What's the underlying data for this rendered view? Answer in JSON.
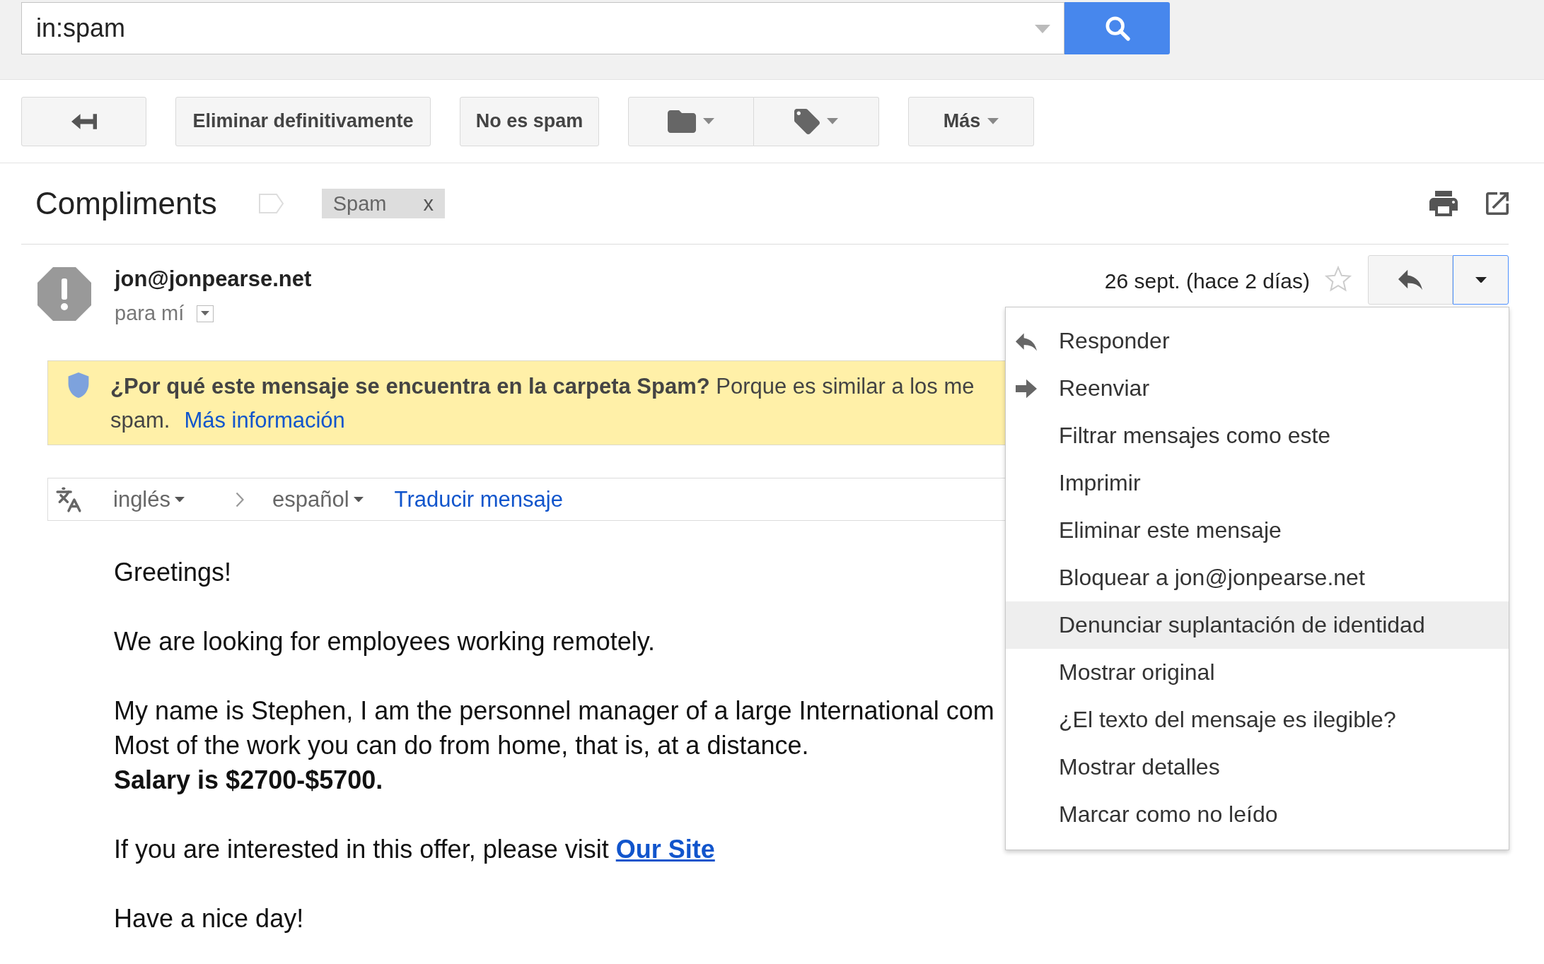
{
  "search": {
    "value": "in:spam"
  },
  "toolbar": [
    {
      "kind": "back"
    },
    {
      "kind": "text",
      "label": "Eliminar definitivamente"
    },
    {
      "kind": "text",
      "label": "No es spam"
    },
    {
      "kind": "group"
    },
    {
      "kind": "dropdown",
      "label": "Más"
    }
  ],
  "thread": {
    "subject": "Compliments",
    "tag": {
      "label": "Spam",
      "remove": "x"
    }
  },
  "message": {
    "sender": "jon@jonpearse.net",
    "recipient": "para mí",
    "date": "26 sept. (hace 2 días)",
    "starred": false
  },
  "spam_banner": {
    "lines": [
      "**¿Por qué este mensaje se encuentra en la carpeta Spam?** Porque es similar a los me",
      "spam."
    ],
    "link": "Más información"
  },
  "translation": {
    "from": "inglés",
    "to": "español",
    "action": "Traducir mensaje"
  },
  "body": [
    {
      "lines": [
        {
          "text": "Greetings!",
          "bold": false
        }
      ]
    },
    {
      "lines": [
        {
          "text": "We are looking for employees working remotely.",
          "bold": false
        }
      ]
    },
    {
      "lines": [
        {
          "text": "My name is Stephen, I am the personnel manager of a large International com",
          "bold": false
        },
        {
          "text": "Most of the work you can do from home, that is, at a distance.",
          "bold": false
        },
        {
          "text": "Salary is $2700-$5700.",
          "bold": true
        }
      ]
    },
    {
      "lines": [
        {
          "text": "If you are interested in this offer, please visit",
          "bold": false,
          "link": "Our Site"
        }
      ]
    },
    {
      "lines": [
        {
          "text": "Have a nice day!",
          "bold": false
        }
      ]
    }
  ],
  "menu": [
    {
      "label": "Responder",
      "kind": "reply",
      "selected": false
    },
    {
      "label": "Reenviar",
      "kind": "forward",
      "selected": false
    },
    {
      "label": "Filtrar mensajes como este",
      "kind": "plain",
      "selected": false
    },
    {
      "label": "Imprimir",
      "kind": "plain",
      "selected": false
    },
    {
      "label": "Eliminar este mensaje",
      "kind": "plain",
      "selected": false
    },
    {
      "label": "Bloquear a jon@jonpearse.net",
      "kind": "plain",
      "selected": false
    },
    {
      "label": "Denunciar suplantación de identidad",
      "kind": "plain",
      "selected": true
    },
    {
      "label": "Mostrar original",
      "kind": "plain",
      "selected": false
    },
    {
      "label": "¿El texto del mensaje es ilegible?",
      "kind": "plain",
      "selected": false
    },
    {
      "label": "Mostrar detalles",
      "kind": "plain",
      "selected": false
    },
    {
      "label": "Marcar como no leído",
      "kind": "plain",
      "selected": false
    }
  ]
}
